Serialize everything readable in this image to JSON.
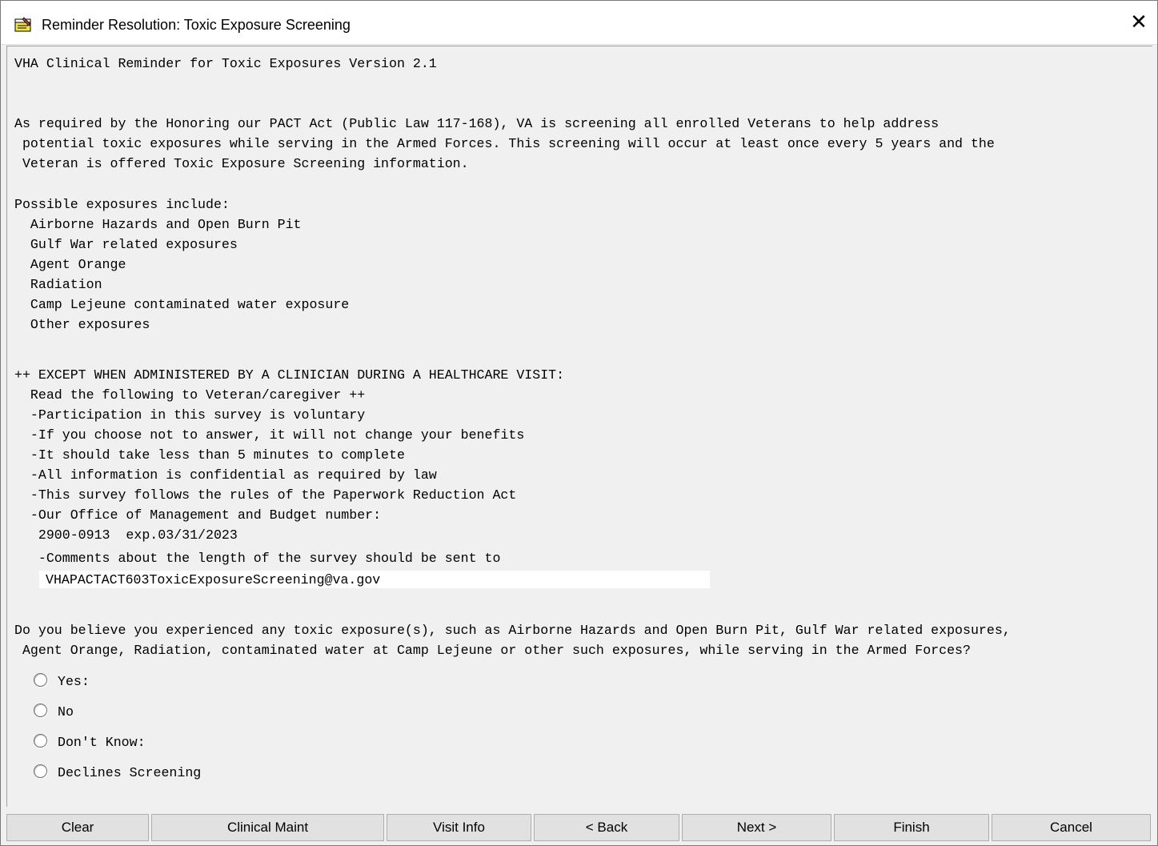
{
  "window": {
    "title": "Reminder Resolution: Toxic Exposure Screening",
    "close_glyph": "✕"
  },
  "content": {
    "lines": [
      "VHA Clinical Reminder for Toxic Exposures Version 2.1",
      "As required by the Honoring our PACT Act (Public Law 117-168), VA is screening all enrolled Veterans to help address",
      " potential toxic exposures while serving in the Armed Forces. This screening will occur at least once every 5 years and the",
      " Veteran is offered Toxic Exposure Screening information.",
      "Possible exposures include:",
      "  Airborne Hazards and Open Burn Pit",
      "  Gulf War related exposures",
      "  Agent Orange",
      "  Radiation",
      "  Camp Lejeune contaminated water exposure",
      "  Other exposures",
      "++ EXCEPT WHEN ADMINISTERED BY A CLINICIAN DURING A HEALTHCARE VISIT:",
      "  Read the following to Veteran/caregiver ++",
      "  -Participation in this survey is voluntary",
      "  -If you choose not to answer, it will not change your benefits",
      "  -It should take less than 5 minutes to complete",
      "  -All information is confidential as required by law",
      "  -This survey follows the rules of the Paperwork Reduction Act",
      "  -Our Office of Management and Budget number:",
      "   2900-0913  exp.03/31/2023",
      "   -Comments about the length of the survey should be sent to",
      "Do you believe you experienced any toxic exposure(s), such as Airborne Hazards and Open Burn Pit, Gulf War related exposures,",
      " Agent Orange, Radiation, contaminated water at Camp Lejeune or other such exposures, while serving in the Armed Forces?"
    ],
    "email": "VHAPACTACT603ToxicExposureScreening@va.gov"
  },
  "options": [
    {
      "label": "Yes:"
    },
    {
      "label": "No"
    },
    {
      "label": "Don't Know:"
    },
    {
      "label": "Declines Screening"
    }
  ],
  "buttons": {
    "clear": "Clear",
    "clinical_maint": "Clinical Maint",
    "visit_info": "Visit Info",
    "back": "< Back",
    "next": "Next >",
    "finish": "Finish",
    "cancel": "Cancel"
  }
}
